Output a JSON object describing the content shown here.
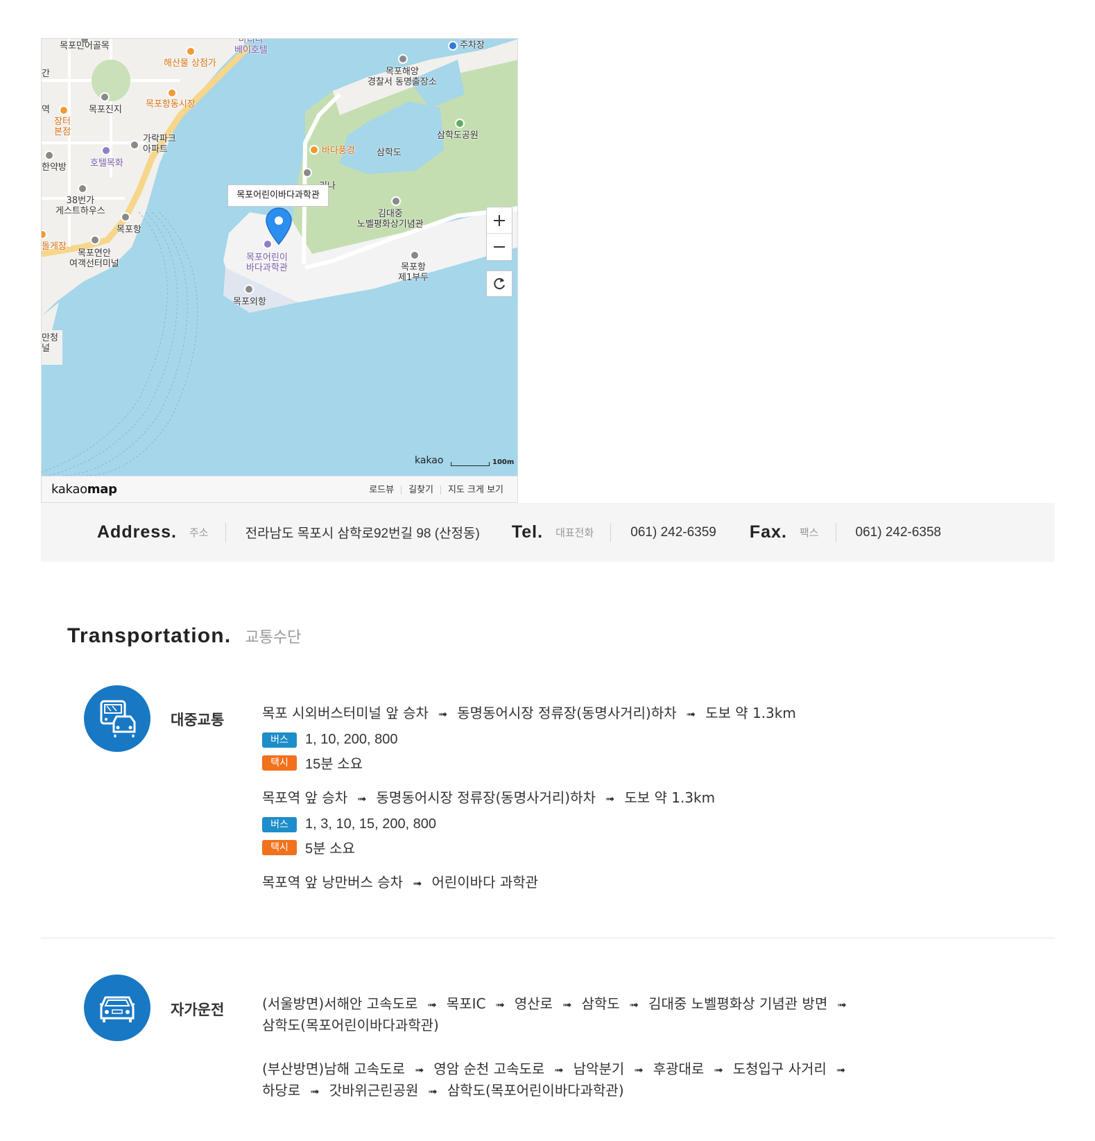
{
  "map": {
    "popup": "목포어린이바다과학관",
    "labels": {
      "l1": "목포민어골목",
      "l2": "해산물 상점가",
      "l3": "마리나\n베이호텔",
      "l4": "주차장",
      "l5": "목포해양\n경찰서 동명출장소",
      "l6": "목포진지",
      "l7": "목포항동시장",
      "l8": "장터\n본점",
      "l9": "가락파크\n아파트",
      "l10": "삼학도공원",
      "l11": "바다풍경",
      "l12": "삼학도",
      "l13": "호텔목화",
      "l14": "한약방",
      "l15": "38번가\n게스트하우스",
      "l16": "리나",
      "l17": "김대중\n노벨평화상기념관",
      "l18": "목포항",
      "l19": "돌게장",
      "l20": "목포연안\n여객선터미널",
      "l21": "목포어린이\n바다과학관",
      "l22": "목포항\n제1부두",
      "l23": "목포외항",
      "l24": "만청\n널",
      "l25": "간",
      "l26": "역"
    },
    "scale_brand": "kakao",
    "scale_text": "100m",
    "logo_light": "kakao",
    "logo_bold": "map",
    "links": [
      "로드뷰",
      "길찾기",
      "지도 크게 보기"
    ]
  },
  "info": {
    "address_title": "Address.",
    "address_sub": "주소",
    "address_value": "전라남도 목포시 삼학로92번길 98 (산정동)",
    "tel_title": "Tel.",
    "tel_sub": "대표전화",
    "tel_value": "061) 242-6359",
    "fax_title": "Fax.",
    "fax_sub": "팩스",
    "fax_value": "061) 242-6358"
  },
  "transport": {
    "title": "Transportation.",
    "sub": "교통수단",
    "public": {
      "label": "대중교통",
      "route1": [
        "목포 시외버스터미널 앞 승차",
        "동명동어시장 정류장(동명사거리)하차",
        "도보 약 1.3km"
      ],
      "route1_bus": "1, 10, 200, 800",
      "route1_taxi": "15분 소요",
      "route2": [
        "목포역 앞 승차",
        "동명동어시장 정류장(동명사거리)하차",
        "도보 약 1.3km"
      ],
      "route2_bus": "1, 3, 10, 15, 200, 800",
      "route2_taxi": "5분 소요",
      "route3": [
        "목포역 앞 낭만버스 승차",
        "어린이바다 과학관"
      ],
      "bus_tag": "버스",
      "taxi_tag": "택시"
    },
    "car": {
      "label": "자가운전",
      "route1_line1": [
        "(서울방면)서해안 고속도로",
        "목포IC",
        "영산로",
        "삼학도",
        "김대중 노벨평화상 기념관 방면"
      ],
      "route1_line2": "삼학도(목포어린이바다과학관)",
      "route2_line1": [
        "(부산방면)남해 고속도로",
        "영암 순천 고속도로",
        "남악분기",
        "후광대로",
        "도청입구 사거리"
      ],
      "route2_line2": [
        "하당로",
        "갓바위근린공원",
        "삼학도(목포어린이바다과학관)"
      ]
    }
  },
  "colors": {
    "icon_bg": "#1878c4",
    "bus": "#1e8dc9",
    "taxi": "#f2711c",
    "water": "#a5d6ea"
  }
}
